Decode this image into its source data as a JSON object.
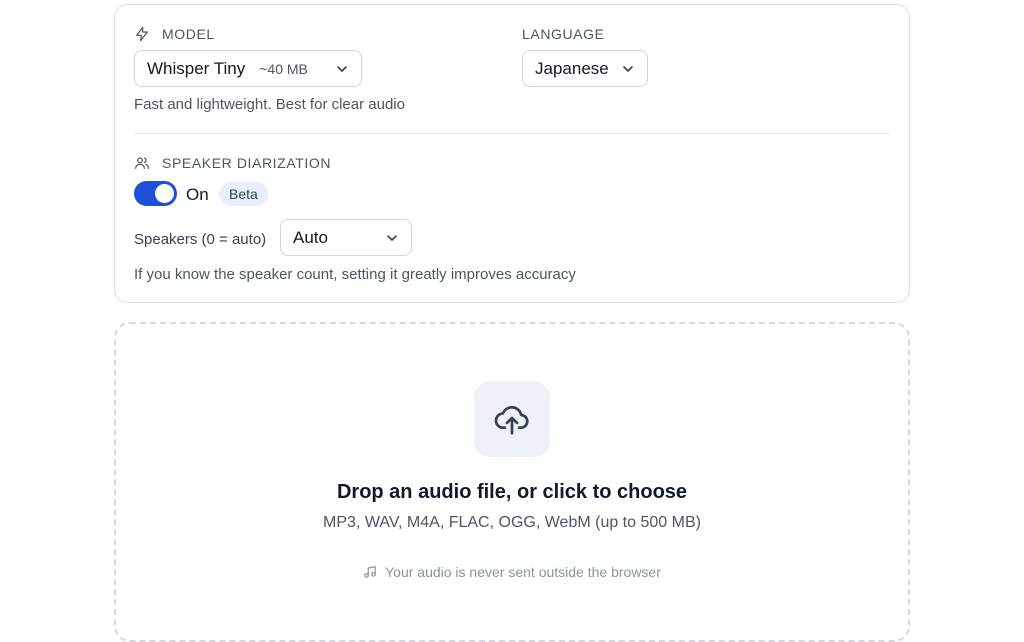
{
  "model": {
    "label": "MODEL",
    "selected": "Whisper Tiny",
    "size": "~40 MB",
    "hint": "Fast and lightweight. Best for clear audio",
    "icon": "lightning-icon"
  },
  "language": {
    "label": "LANGUAGE",
    "selected": "Japanese"
  },
  "diarization": {
    "label": "SPEAKER DIARIZATION",
    "icon": "users-icon",
    "toggle_state": "On",
    "enabled": true,
    "badge": "Beta",
    "speakers_label": "Speakers (0 = auto)",
    "speakers_selected": "Auto",
    "hint": "If you know the speaker count, setting it greatly improves accuracy"
  },
  "dropzone": {
    "icon": "cloud-upload-icon",
    "title": "Drop an audio file, or click to choose",
    "formats": "MP3, WAV, M4A, FLAC, OGG, WebM (up to 500 MB)",
    "privacy_icon": "music-note-icon",
    "privacy": "Your audio is never sent outside the browser"
  },
  "colors": {
    "accent": "#1d4fd7",
    "badge_bg": "#e8eefb",
    "border": "#d8dde5",
    "muted_text": "#4b5563"
  }
}
